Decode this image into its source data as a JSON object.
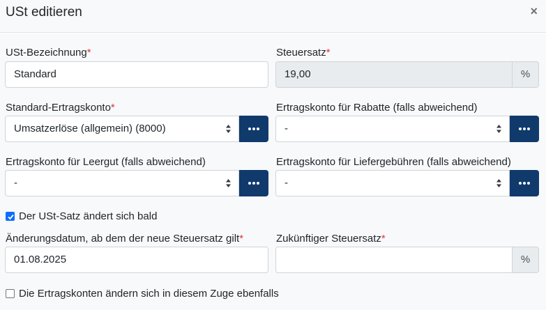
{
  "dialog": {
    "title": "USt editieren",
    "close_symbol": "×"
  },
  "form": {
    "bezeichnung": {
      "label": "USt-Bezeichnung",
      "required": "*",
      "value": "Standard"
    },
    "steuersatz": {
      "label": "Steuersatz",
      "required": "*",
      "value": "19,00",
      "unit": "%"
    },
    "standard_ertragskonto": {
      "label": "Standard-Ertragskonto",
      "required": "*",
      "value": "Umsatzerlöse (allgemein) (8000)"
    },
    "rabatte": {
      "label": "Ertragskonto für Rabatte (falls abweichend)",
      "value": "-"
    },
    "leergut": {
      "label": "Ertragskonto für Leergut (falls abweichend)",
      "value": "-"
    },
    "liefergebuehren": {
      "label": "Ertragskonto für Liefergebühren (falls abweichend)",
      "value": "-"
    },
    "satz_aendert": {
      "label": "Der USt-Satz ändert sich bald",
      "checked": true
    },
    "aenderungsdatum": {
      "label": "Änderungsdatum, ab dem der neue Steuersatz gilt",
      "required": "*",
      "value": "01.08.2025"
    },
    "zukuenftiger_satz": {
      "label": "Zukünftiger Steuersatz",
      "required": "*",
      "value": "",
      "unit": "%"
    },
    "konten_aendern": {
      "label": "Die Ertragskonten ändern sich in diesem Zuge ebenfalls",
      "checked": false
    }
  },
  "colors": {
    "primary_button": "#103a6c",
    "required": "#dc3545",
    "checkbox": "#0d6efd"
  }
}
